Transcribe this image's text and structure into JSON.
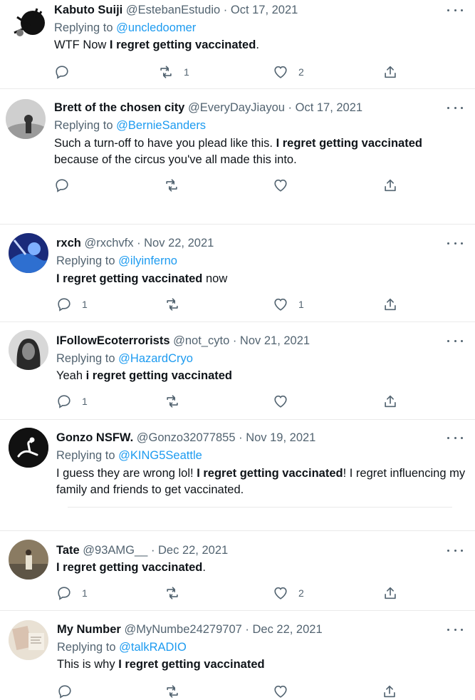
{
  "tweets": [
    {
      "name": "Kabuto Suiji",
      "handle": "@EstebanEstudio",
      "date": "· Oct 17, 2021",
      "replying_prefix": "Replying to",
      "replying_to": "@uncledoomer",
      "text_before": "WTF Now ",
      "text_bold": "I regret getting vaccinated",
      "text_after": ".",
      "reply_count": "",
      "retweet_count": "1",
      "like_count": "2"
    },
    {
      "name": "Brett of the chosen city",
      "handle": "@EveryDayJiayou",
      "date": "· Oct 17, 2021",
      "replying_prefix": "Replying to",
      "replying_to": "@BernieSanders",
      "text_before": "Such a turn-off to have you plead like this. ",
      "text_bold": "I regret getting vaccinated",
      "text_after": " because of the circus you've all made this into.",
      "reply_count": "",
      "retweet_count": "",
      "like_count": ""
    },
    {
      "name": "rxch",
      "handle": "@rxchvfx",
      "date": "· Nov 22, 2021",
      "replying_prefix": "Replying to",
      "replying_to": "@ilyinferno",
      "text_before": "",
      "text_bold": "I regret getting vaccinated",
      "text_after": " now",
      "reply_count": "1",
      "retweet_count": "",
      "like_count": "1"
    },
    {
      "name": "IFollowEcoterrorists",
      "handle": "@not_cyto",
      "date": "· Nov 21, 2021",
      "replying_prefix": "Replying to",
      "replying_to": "@HazardCryo",
      "text_before": "Yeah ",
      "text_bold": "i regret getting vaccinated",
      "text_after": "",
      "reply_count": "1",
      "retweet_count": "",
      "like_count": ""
    },
    {
      "name": "Gonzo NSFW.",
      "handle": "@Gonzo32077855",
      "date": "· Nov 19, 2021",
      "replying_prefix": "Replying to",
      "replying_to": "@KING5Seattle",
      "text_before": "I guess they are wrong lol! ",
      "text_bold": "I regret getting vaccinated",
      "text_after": "! I regret influencing my family and friends to get vaccinated.",
      "reply_count": "",
      "retweet_count": "",
      "like_count": ""
    },
    {
      "name": "Tate",
      "handle": "@93AMG__",
      "date": "· Dec 22, 2021",
      "replying_prefix": "",
      "replying_to": "",
      "text_before": "",
      "text_bold": "I regret getting vaccinated",
      "text_after": ".",
      "reply_count": "1",
      "retweet_count": "",
      "like_count": "2"
    },
    {
      "name": "My Number",
      "handle": "@MyNumbe24279707",
      "date": "· Dec 22, 2021",
      "replying_prefix": "Replying to",
      "replying_to": "@talkRADIO",
      "text_before": "This is why ",
      "text_bold": "I regret getting vaccinated",
      "text_after": "",
      "reply_count": "",
      "retweet_count": "",
      "like_count": ""
    }
  ],
  "icons": {
    "reply": "reply-icon",
    "retweet": "retweet-icon",
    "like": "heart-icon",
    "share": "share-icon",
    "more": "more-icon"
  },
  "colors": {
    "link": "#1d9bf0",
    "muted": "#536471",
    "text": "#0f1419"
  }
}
